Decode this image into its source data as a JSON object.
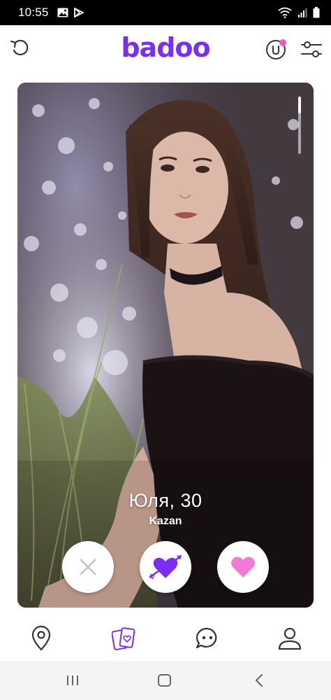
{
  "status_bar": {
    "time": "10:55",
    "left_icons": [
      "image-icon",
      "play-store-icon"
    ],
    "right_icons": [
      "wifi-icon",
      "signal-icon",
      "battery-icon"
    ]
  },
  "header": {
    "logo": "badoo",
    "back_icon": "undo-icon",
    "badge_icon": "encounters-badge-icon",
    "filter_icon": "filter-sliders-icon",
    "accent_color": "#7b2cf5",
    "badge_dot_color": "#f05ac8"
  },
  "profile": {
    "name_age": "Юля, 30",
    "city": "Kazan"
  },
  "actions": [
    {
      "name": "dislike",
      "icon": "close-icon"
    },
    {
      "name": "crush",
      "icon": "heart-arrow-icon"
    },
    {
      "name": "like",
      "icon": "heart-icon"
    }
  ],
  "bottom_nav": [
    {
      "name": "nearby",
      "icon": "location-pin-icon"
    },
    {
      "name": "encounters",
      "icon": "cards-icon",
      "active": true
    },
    {
      "name": "chats",
      "icon": "chat-bubble-icon"
    },
    {
      "name": "profile",
      "icon": "person-icon"
    }
  ],
  "system_nav": [
    "recents-icon",
    "home-icon",
    "back-icon"
  ]
}
